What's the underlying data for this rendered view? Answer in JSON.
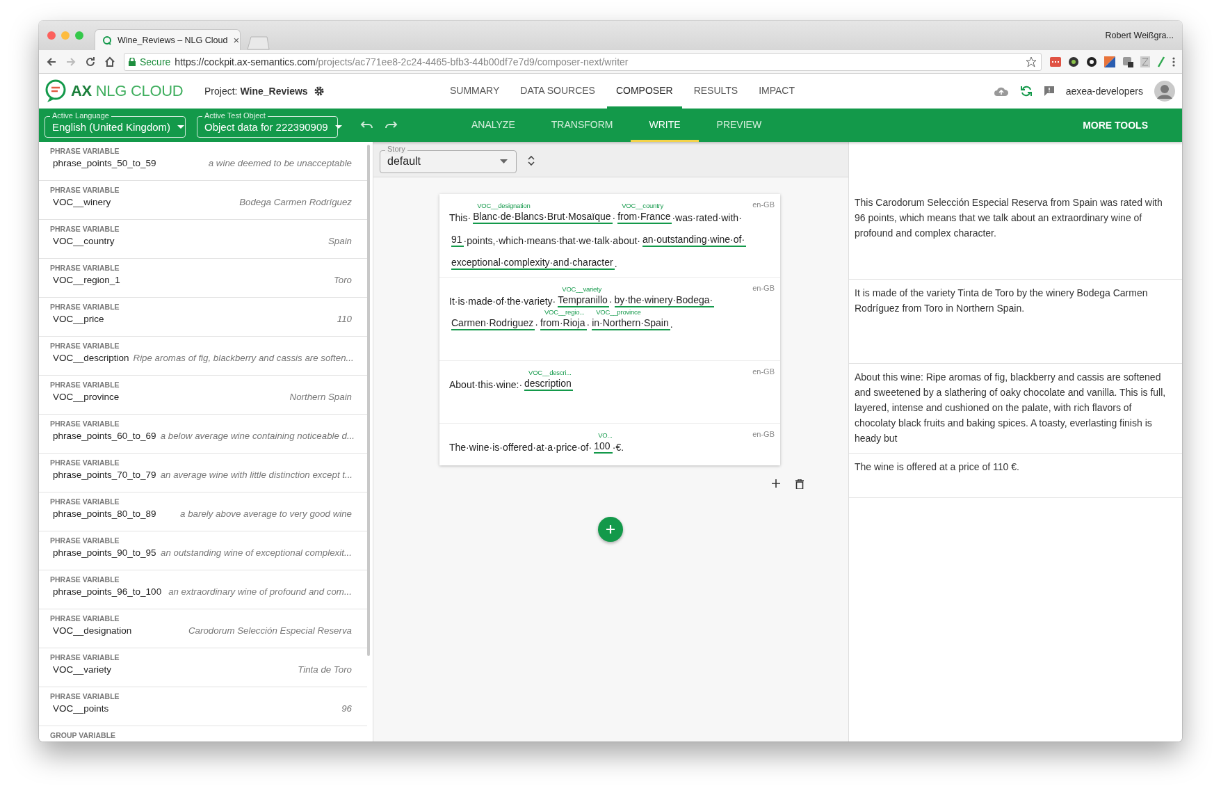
{
  "browser": {
    "tab_title": "Wine_Reviews – NLG Cloud",
    "tab_close": "×",
    "profile": "Robert Weißgra...",
    "secure_label": "Secure",
    "url_host": "https://cockpit.ax-semantics.com",
    "url_path": "/projects/ac771ee8-2c24-4465-bfb3-44b00df7e7d9/composer-next/writer"
  },
  "header": {
    "logo_text": "**AX** NLG CLOUD",
    "project_label": "Project:",
    "project_name": "Wine_Reviews",
    "user": "aexea-developers",
    "nav": [
      {
        "label": "SUMMARY",
        "selected": false
      },
      {
        "label": "DATA SOURCES",
        "selected": false
      },
      {
        "label": "COMPOSER",
        "selected": true
      },
      {
        "label": "RESULTS",
        "selected": false
      },
      {
        "label": "IMPACT",
        "selected": false
      }
    ]
  },
  "toolbar": {
    "language": {
      "label": "Active Language",
      "value": "English (United Kingdom)"
    },
    "test_object": {
      "label": "Active Test Object",
      "value": "Object data for 222390909"
    },
    "more_tools": "MORE TOOLS",
    "tabs": [
      {
        "label": "ANALYZE",
        "selected": false
      },
      {
        "label": "TRANSFORM",
        "selected": false
      },
      {
        "label": "WRITE",
        "selected": true
      },
      {
        "label": "PREVIEW",
        "selected": false
      }
    ]
  },
  "variables": [
    {
      "type": "PHRASE VARIABLE",
      "name": "phrase_points_50_to_59",
      "value": "a wine deemed to be unacceptable"
    },
    {
      "type": "PHRASE VARIABLE",
      "name": "VOC__winery",
      "value": "Bodega Carmen Rodríguez"
    },
    {
      "type": "PHRASE VARIABLE",
      "name": "VOC__country",
      "value": "Spain"
    },
    {
      "type": "PHRASE VARIABLE",
      "name": "VOC__region_1",
      "value": "Toro"
    },
    {
      "type": "PHRASE VARIABLE",
      "name": "VOC__price",
      "value": "110"
    },
    {
      "type": "PHRASE VARIABLE",
      "name": "VOC__description",
      "value": "Ripe aromas of fig, blackberry and cassis are soften..."
    },
    {
      "type": "PHRASE VARIABLE",
      "name": "VOC__province",
      "value": "Northern Spain"
    },
    {
      "type": "PHRASE VARIABLE",
      "name": "phrase_points_60_to_69",
      "value": "a below average wine containing noticeable d..."
    },
    {
      "type": "PHRASE VARIABLE",
      "name": "phrase_points_70_to_79",
      "value": "an average wine with little distinction except t..."
    },
    {
      "type": "PHRASE VARIABLE",
      "name": "phrase_points_80_to_89",
      "value": "a barely above average to very good wine"
    },
    {
      "type": "PHRASE VARIABLE",
      "name": "phrase_points_90_to_95",
      "value": "an outstanding wine of exceptional complexit..."
    },
    {
      "type": "PHRASE VARIABLE",
      "name": "phrase_points_96_to_100",
      "value": "an extraordinary wine of profound and com..."
    },
    {
      "type": "PHRASE VARIABLE",
      "name": "VOC__designation",
      "value": "Carodorum Selección Especial Reserva"
    },
    {
      "type": "PHRASE VARIABLE",
      "name": "VOC__variety",
      "value": "Tinta de Toro"
    },
    {
      "type": "PHRASE VARIABLE",
      "name": "VOC__points",
      "value": "96"
    },
    {
      "type": "GROUP VARIABLE"
    }
  ],
  "story": {
    "label": "Story",
    "value": "default"
  },
  "sentences": [
    {
      "locale": "en-GB",
      "lines": [
        [
          {
            "kind": "text",
            "text": "This·"
          },
          {
            "kind": "variable",
            "text": "Blanc·de·Blancs·Brut·Mosaïque",
            "label": "VOC__designation"
          },
          {
            "kind": "text",
            "text": "·"
          },
          {
            "kind": "variable",
            "text": "from·France",
            "label": "VOC__country"
          },
          {
            "kind": "text",
            "text": "·was·rated·with·"
          }
        ],
        [
          {
            "kind": "variable",
            "text": "91"
          },
          {
            "kind": "text",
            "text": "·points,·which·means·that·we·talk·about·"
          },
          {
            "kind": "variable",
            "text": "an·outstanding·wine·of·"
          }
        ],
        [
          {
            "kind": "variable",
            "text": "exceptional·complexity·and·character"
          },
          {
            "kind": "text",
            "text": "."
          }
        ]
      ]
    },
    {
      "locale": "en-GB",
      "lines": [
        [
          {
            "kind": "text",
            "text": "It·is·made·of·the·variety·"
          },
          {
            "kind": "variable",
            "text": "Tempranillo",
            "label": "VOC__variety"
          },
          {
            "kind": "text",
            "text": "·"
          },
          {
            "kind": "variable",
            "text": "by·the·winery·Bodega·"
          }
        ],
        [
          {
            "kind": "variable",
            "text": "Carmen·Rodriguez"
          },
          {
            "kind": "text",
            "text": "·"
          },
          {
            "kind": "variable",
            "text": "from·Rioja",
            "label": "VOC__regio..."
          },
          {
            "kind": "text",
            "text": "·"
          },
          {
            "kind": "variable",
            "text": "in·Northern·Spain",
            "label": "VOC__province"
          },
          {
            "kind": "text",
            "text": "."
          }
        ]
      ]
    },
    {
      "locale": "en-GB",
      "lines": [
        [
          {
            "kind": "text",
            "text": "About·this·wine:·"
          },
          {
            "kind": "variable",
            "text": "description",
            "label": "VOC__descri..."
          }
        ]
      ]
    },
    {
      "locale": "en-GB",
      "lines": [
        [
          {
            "kind": "text",
            "text": "The·wine·is·offered·at·a·price·of·"
          },
          {
            "kind": "variable",
            "text": "100",
            "label": "VO..."
          },
          {
            "kind": "text",
            "text": "·€."
          }
        ]
      ]
    }
  ],
  "preview": [
    "This Carodorum Selección Especial Reserva from Spain was rated with 96 points, which means that we talk about an extraordinary wine of profound and complex character.",
    "It is made of the variety Tinta de Toro by the winery Bodega Carmen Rodríguez from Toro in Northern Spain.",
    "About this wine: Ripe aromas of fig, blackberry and cassis are softened and sweetened by a slathering of oaky chocolate and vanilla. This is full, layered, intense and cushioned on the palate, with rich flavors of chocolaty black fruits and baking spices. A toasty, everlasting finish is heady but",
    "The wine is offered at a price of 110 €."
  ]
}
